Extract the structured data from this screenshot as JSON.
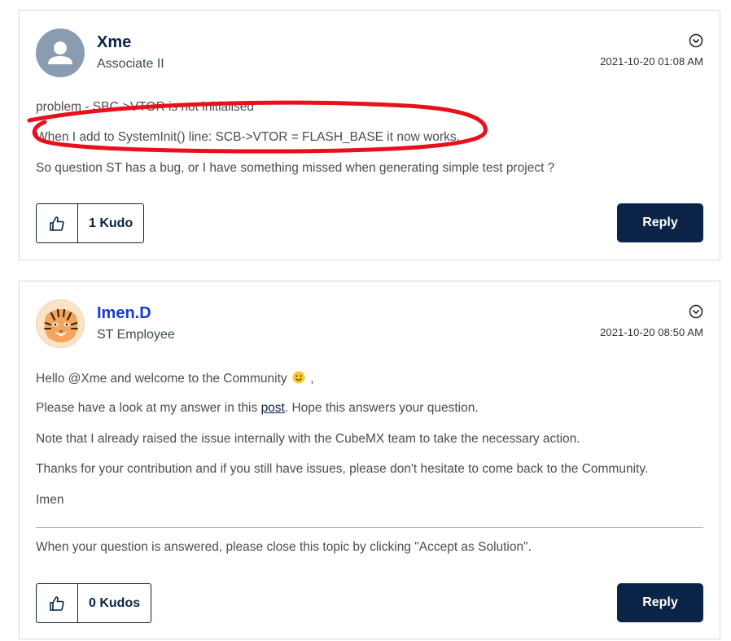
{
  "posts": [
    {
      "username": "Xme",
      "rank": "Associate II",
      "timestamp": "2021-10-20 01:08 AM",
      "avatar_icon": "default-user-icon",
      "paragraphs": [
        "problem - SBC->VTOR is not initialised",
        "When I add to SystemInit() line: SCB->VTOR = FLASH_BASE it now works.",
        "So question ST has a bug, or I have something missed when generating simple test project ?"
      ],
      "kudo_label": "1 Kudo",
      "reply_label": "Reply"
    },
    {
      "username": "Imen.D",
      "rank": "ST Employee",
      "timestamp": "2021-10-20 08:50 AM",
      "avatar_icon": "tiger-avatar-icon",
      "greeting_before": "Hello @Xme and welcome to the Community",
      "greeting_after": " ,",
      "answer_before": "Please have a look at my answer in this ",
      "answer_link": "post",
      "answer_after": ". Hope this answers your question.",
      "paragraphs": [
        "Note that I already raised the issue internally with the CubeMX team to take the necessary action.",
        "Thanks for your contribution and if you still have issues, please don't hesitate to come back to the Community.",
        "Imen"
      ],
      "signature": "When your question is answered, please close this topic by clicking \"Accept as Solution\".",
      "kudo_label": "0 Kudos",
      "reply_label": "Reply"
    }
  ],
  "colors": {
    "brand_navy": "#0b2346",
    "link_blue": "#1a3bd4",
    "annotation_red": "#e8101a"
  }
}
